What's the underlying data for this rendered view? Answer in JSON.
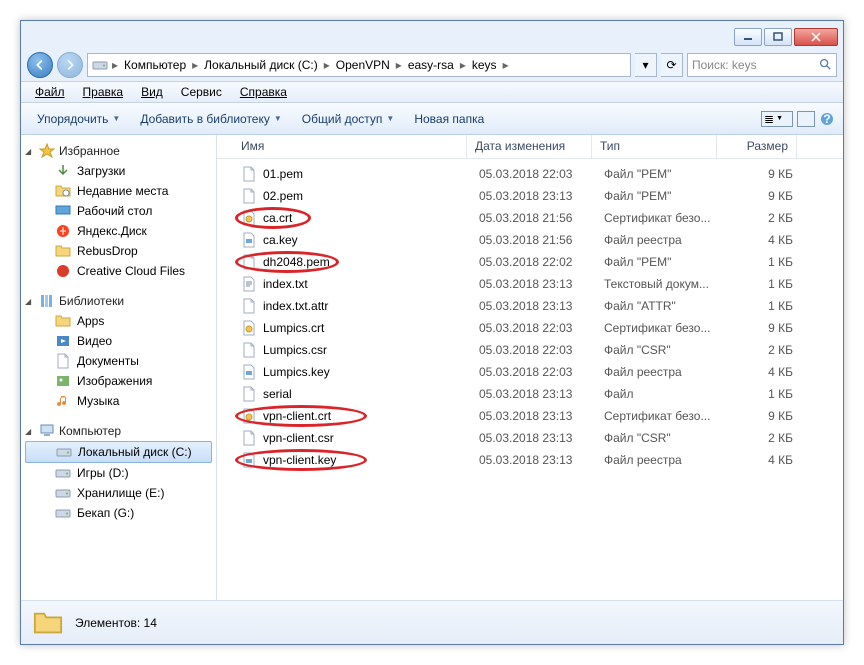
{
  "titlebar": {
    "min": "–",
    "max": "□",
    "close": "×"
  },
  "breadcrumb": [
    "Компьютер",
    "Локальный диск (C:)",
    "OpenVPN",
    "easy-rsa",
    "keys"
  ],
  "search": {
    "placeholder": "Поиск: keys"
  },
  "menu": {
    "file": "Файл",
    "edit": "Правка",
    "view": "Вид",
    "tools": "Сервис",
    "help": "Справка"
  },
  "toolbar": {
    "organize": "Упорядочить",
    "addlib": "Добавить в библиотеку",
    "share": "Общий доступ",
    "newfolder": "Новая папка"
  },
  "columns": {
    "name": "Имя",
    "date": "Дата изменения",
    "type": "Тип",
    "size": "Размер"
  },
  "sidebar": {
    "favorites": {
      "label": "Избранное",
      "items": [
        {
          "label": "Загрузки",
          "icon": "download"
        },
        {
          "label": "Недавние места",
          "icon": "recent"
        },
        {
          "label": "Рабочий стол",
          "icon": "desktop"
        },
        {
          "label": "Яндекс.Диск",
          "icon": "yadisk"
        },
        {
          "label": "RebusDrop",
          "icon": "folder-o"
        },
        {
          "label": "Creative Cloud Files",
          "icon": "cc"
        }
      ]
    },
    "libraries": {
      "label": "Библиотеки",
      "items": [
        {
          "label": "Apps",
          "icon": "folder"
        },
        {
          "label": "Видео",
          "icon": "video"
        },
        {
          "label": "Документы",
          "icon": "doc"
        },
        {
          "label": "Изображения",
          "icon": "pic"
        },
        {
          "label": "Музыка",
          "icon": "music"
        }
      ]
    },
    "computer": {
      "label": "Компьютер",
      "items": [
        {
          "label": "Локальный диск (C:)",
          "icon": "drive",
          "selected": true
        },
        {
          "label": "Игры (D:)",
          "icon": "drive"
        },
        {
          "label": "Хранилище (E:)",
          "icon": "drive"
        },
        {
          "label": "Бекап (G:)",
          "icon": "drive"
        }
      ]
    }
  },
  "files": [
    {
      "name": "01.pem",
      "date": "05.03.2018 22:03",
      "type": "Файл \"PEM\"",
      "size": "9 КБ",
      "icon": "file",
      "hl": false
    },
    {
      "name": "02.pem",
      "date": "05.03.2018 23:13",
      "type": "Файл \"PEM\"",
      "size": "9 КБ",
      "icon": "file",
      "hl": false
    },
    {
      "name": "ca.crt",
      "date": "05.03.2018 21:56",
      "type": "Сертификат безо...",
      "size": "2 КБ",
      "icon": "cert",
      "hl": true
    },
    {
      "name": "ca.key",
      "date": "05.03.2018 21:56",
      "type": "Файл реестра",
      "size": "4 КБ",
      "icon": "key",
      "hl": false
    },
    {
      "name": "dh2048.pem",
      "date": "05.03.2018 22:02",
      "type": "Файл \"PEM\"",
      "size": "1 КБ",
      "icon": "file",
      "hl": true
    },
    {
      "name": "index.txt",
      "date": "05.03.2018 23:13",
      "type": "Текстовый докум...",
      "size": "1 КБ",
      "icon": "txt",
      "hl": false
    },
    {
      "name": "index.txt.attr",
      "date": "05.03.2018 23:13",
      "type": "Файл \"ATTR\"",
      "size": "1 КБ",
      "icon": "file",
      "hl": false
    },
    {
      "name": "Lumpics.crt",
      "date": "05.03.2018 22:03",
      "type": "Сертификат безо...",
      "size": "9 КБ",
      "icon": "cert",
      "hl": false
    },
    {
      "name": "Lumpics.csr",
      "date": "05.03.2018 22:03",
      "type": "Файл \"CSR\"",
      "size": "2 КБ",
      "icon": "file",
      "hl": false
    },
    {
      "name": "Lumpics.key",
      "date": "05.03.2018 22:03",
      "type": "Файл реестра",
      "size": "4 КБ",
      "icon": "key",
      "hl": false
    },
    {
      "name": "serial",
      "date": "05.03.2018 23:13",
      "type": "Файл",
      "size": "1 КБ",
      "icon": "file",
      "hl": false
    },
    {
      "name": "vpn-client.crt",
      "date": "05.03.2018 23:13",
      "type": "Сертификат безо...",
      "size": "9 КБ",
      "icon": "cert",
      "hl": true
    },
    {
      "name": "vpn-client.csr",
      "date": "05.03.2018 23:13",
      "type": "Файл \"CSR\"",
      "size": "2 КБ",
      "icon": "file",
      "hl": false
    },
    {
      "name": "vpn-client.key",
      "date": "05.03.2018 23:13",
      "type": "Файл реестра",
      "size": "4 КБ",
      "icon": "key",
      "hl": true
    }
  ],
  "status": {
    "text": "Элементов: 14"
  }
}
